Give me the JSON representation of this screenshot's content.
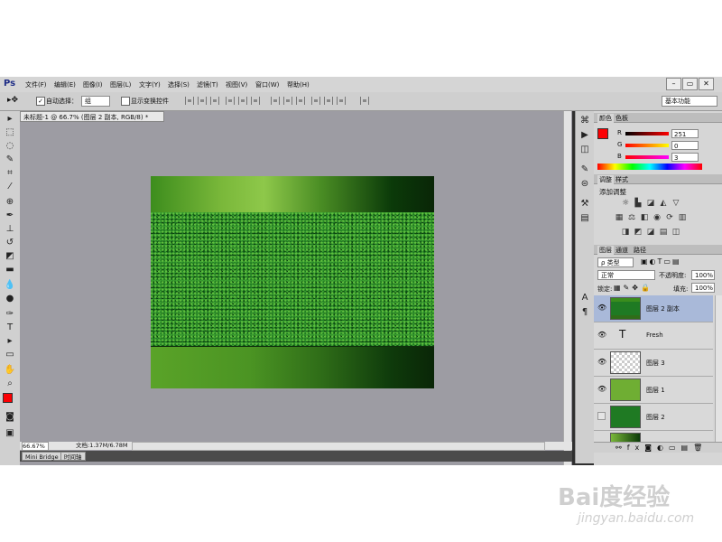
{
  "app": {
    "logo": "Ps",
    "menu": [
      "文件(F)",
      "编辑(E)",
      "图像(I)",
      "图层(L)",
      "文字(Y)",
      "选择(S)",
      "滤镜(T)",
      "视图(V)",
      "窗口(W)",
      "帮助(H)"
    ],
    "window_buttons": [
      "–",
      "▭",
      "✕"
    ]
  },
  "options_bar": {
    "auto_select_label": "自动选择：",
    "auto_select_value": "组",
    "show_transform_label": "显示变换控件",
    "workspace": "基本功能"
  },
  "document": {
    "tab_title": "未标题-1 @ 66.7% (图层 2 副本, RGB/8) *",
    "zoom": "66.67%",
    "doc_info": "文档:1.37M/6.78M"
  },
  "bottom_tabs": [
    "Mini Bridge",
    "时间轴"
  ],
  "color_panel": {
    "tabs": [
      "颜色",
      "色板"
    ],
    "channels": [
      {
        "label": "R",
        "value": "251"
      },
      {
        "label": "G",
        "value": "0"
      },
      {
        "label": "B",
        "value": "3"
      }
    ],
    "foreground": "#fb0003"
  },
  "adjustments_panel": {
    "tabs": [
      "调整",
      "样式"
    ],
    "heading": "添加调整"
  },
  "layers_panel": {
    "tabs": [
      "图层",
      "通道",
      "路径"
    ],
    "filter_kind": "ρ 类型",
    "blend_mode": "正常",
    "opacity_label": "不透明度:",
    "opacity_value": "100%",
    "lock_label": "锁定:",
    "fill_label": "填充:",
    "fill_value": "100%",
    "layers": [
      {
        "name": "图层 2 副本",
        "visible": true,
        "active": true,
        "thumb": "grass"
      },
      {
        "name": "Fresh",
        "visible": true,
        "active": false,
        "thumb": "text"
      },
      {
        "name": "图层 3",
        "visible": true,
        "active": false,
        "thumb": "transparent"
      },
      {
        "name": "图层 1",
        "visible": true,
        "active": false,
        "thumb": "green"
      },
      {
        "name": "图层 2",
        "visible": false,
        "active": false,
        "thumb": "grass"
      }
    ]
  },
  "watermark": {
    "brand": "Bai度经验",
    "url": "jingyan.baidu.com"
  }
}
